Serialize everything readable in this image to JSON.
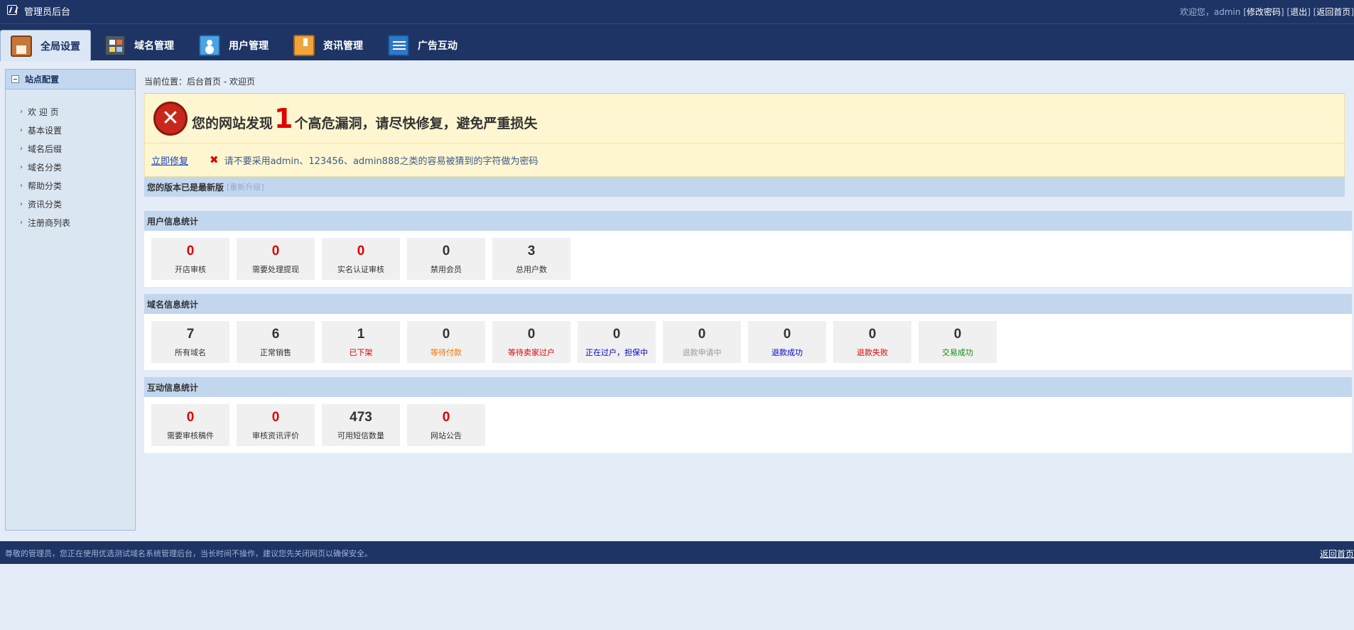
{
  "topbar": {
    "title": "管理员后台",
    "welcome": "欢迎您，admin",
    "change_password": "修改密码",
    "logout": "退出",
    "back_home": "返回首页"
  },
  "nav": [
    {
      "label": "全局设置",
      "icon": "home-icon",
      "active": true
    },
    {
      "label": "域名管理",
      "icon": "domain-icon",
      "active": false
    },
    {
      "label": "用户管理",
      "icon": "user-icon",
      "active": false
    },
    {
      "label": "资讯管理",
      "icon": "news-icon",
      "active": false
    },
    {
      "label": "广告互动",
      "icon": "ad-icon",
      "active": false
    }
  ],
  "sidebar": {
    "title": "站点配置",
    "items": [
      "欢 迎 页",
      "基本设置",
      "域名后缀",
      "域名分类",
      "帮助分类",
      "资讯分类",
      "注册商列表"
    ]
  },
  "breadcrumb": "当前位置：后台首页 - 欢迎页",
  "alert": {
    "prefix": "您的网站发现",
    "count": "1",
    "suffix": "个高危漏洞，请尽快修复，避免严重损失",
    "fix_link": "立即修复",
    "tip": "请不要采用admin、123456、admin888之类的容易被猜到的字符做为密码"
  },
  "version": {
    "text": "您的版本已是最新版",
    "upgrade": "[重新升级]"
  },
  "user_stats": {
    "title": "用户信息统计",
    "cards": [
      {
        "value": "0",
        "label": "开店审核",
        "value_color": "#e00000",
        "label_color": "#333333"
      },
      {
        "value": "0",
        "label": "需要处理提现",
        "value_color": "#e00000",
        "label_color": "#333333"
      },
      {
        "value": "0",
        "label": "实名认证审核",
        "value_color": "#e00000",
        "label_color": "#333333"
      },
      {
        "value": "0",
        "label": "禁用会员",
        "value_color": "#333333",
        "label_color": "#333333"
      },
      {
        "value": "3",
        "label": "总用户数",
        "value_color": "#333333",
        "label_color": "#333333"
      }
    ]
  },
  "domain_stats": {
    "title": "域名信息统计",
    "cards": [
      {
        "value": "7",
        "label": "所有域名",
        "value_color": "#333333",
        "label_color": "#333333"
      },
      {
        "value": "6",
        "label": "正常销售",
        "value_color": "#333333",
        "label_color": "#333333"
      },
      {
        "value": "1",
        "label": "已下架",
        "value_color": "#333333",
        "label_color": "#e00000"
      },
      {
        "value": "0",
        "label": "等待付款",
        "value_color": "#333333",
        "label_color": "#f07800"
      },
      {
        "value": "0",
        "label": "等待卖家过户",
        "value_color": "#333333",
        "label_color": "#e00000"
      },
      {
        "value": "0",
        "label": "正在过户，担保中",
        "value_color": "#333333",
        "label_color": "#0000cc"
      },
      {
        "value": "0",
        "label": "退款申请中",
        "value_color": "#333333",
        "label_color": "#999999"
      },
      {
        "value": "0",
        "label": "退款成功",
        "value_color": "#333333",
        "label_color": "#0000cc"
      },
      {
        "value": "0",
        "label": "退款失败",
        "value_color": "#333333",
        "label_color": "#e00000"
      },
      {
        "value": "0",
        "label": "交易成功",
        "value_color": "#333333",
        "label_color": "#108a10"
      }
    ]
  },
  "interact_stats": {
    "title": "互动信息统计",
    "cards": [
      {
        "value": "0",
        "label": "需要审核稿件",
        "value_color": "#e00000",
        "label_color": "#333333"
      },
      {
        "value": "0",
        "label": "审核资讯评价",
        "value_color": "#e00000",
        "label_color": "#333333"
      },
      {
        "value": "473",
        "label": "可用短信数量",
        "value_color": "#333333",
        "label_color": "#333333"
      },
      {
        "value": "0",
        "label": "网站公告",
        "value_color": "#e00000",
        "label_color": "#333333"
      }
    ]
  },
  "footer": {
    "notice": "尊敬的管理员，您正在使用优选测试域名系统管理后台，当长时间不操作，建议您先关闭网页以确保安全。",
    "back_home": "返回首页"
  }
}
